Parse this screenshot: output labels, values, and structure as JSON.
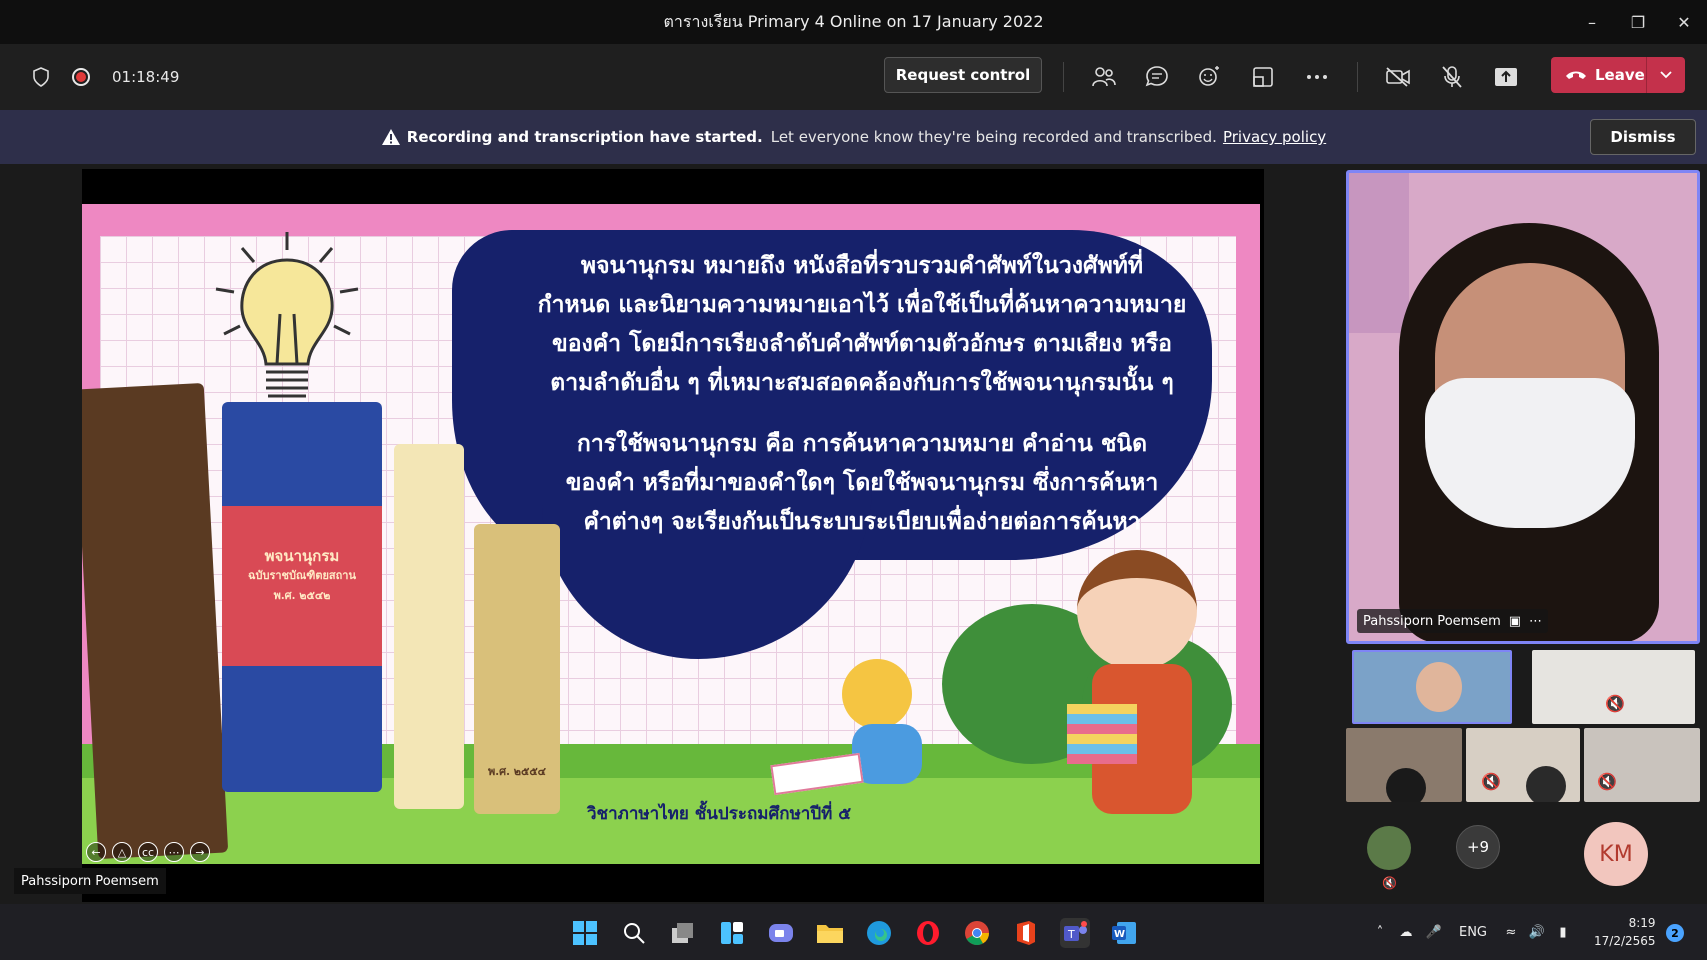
{
  "window": {
    "title": "ตารางเรียน Primary 4 Online on 17 January 2022",
    "controls": [
      "minimize",
      "restore",
      "close"
    ]
  },
  "toolbar": {
    "timer": "01:18:49",
    "request_control": "Request control",
    "leave": "Leave",
    "icons": [
      "shield-icon",
      "record-icon",
      "people-icon",
      "chat-icon",
      "reactions-icon",
      "rooms-icon",
      "more-icon",
      "camera-off-icon",
      "mic-off-icon",
      "share-icon"
    ]
  },
  "banner": {
    "bold_text": "Recording and transcription have started.",
    "text": "Let everyone know they're being recorded and transcribed.",
    "link": "Privacy policy",
    "dismiss": "Dismiss"
  },
  "slide": {
    "paragraph1": [
      "พจนานุกรม หมายถึง หนังสือที่รวบรวมคำศัพท์ในวงศัพท์ที่",
      "กำหนด และนิยามความหมายเอาไว้ เพื่อใช้เป็นที่ค้นหาความหมาย",
      "ของคำ โดยมีการเรียงลำดับคำศัพท์ตามตัวอักษร ตามเสียง หรือ",
      "ตามลำดับอื่น ๆ ที่เหมาะสมสอดคล้องกับการใช้พจนานุกรมนั้น ๆ"
    ],
    "paragraph2": [
      "การใช้พจนานุกรม คือ การค้นหาความหมาย คำอ่าน ชนิด",
      "ของคำ หรือที่มาของคำใดๆ โดยใช้พจนานุกรม ซึ่งการค้นหา",
      "คำต่างๆ จะเรียงกันเป็นระบบระเบียบเพื่อง่ายต่อการค้นหา"
    ],
    "book_label": "พจนานุกรม",
    "book_sub1": "ฉบับราชบัณฑิตยสถาน",
    "book_sub2": "พ.ศ. ๒๕๔๒",
    "book4_year": "พ.ศ. ๒๕๕๔",
    "caption": "วิชาภาษาไทย ชั้นประถมศึกษาปีที่ ๕"
  },
  "presenter": "Pahssiporn Poemsem",
  "participants": {
    "main_name": "Pahssiporn Poemsem",
    "overflow": "+9",
    "initials": "KM"
  },
  "taskbar": {
    "lang": "ENG",
    "time": "8:19",
    "date": "17/2/2565",
    "notifications": "2"
  },
  "colors": {
    "accent": "#7f85f5",
    "leave": "#c4314b",
    "banner": "#2e2f4a",
    "slide_navy": "#16216b"
  }
}
